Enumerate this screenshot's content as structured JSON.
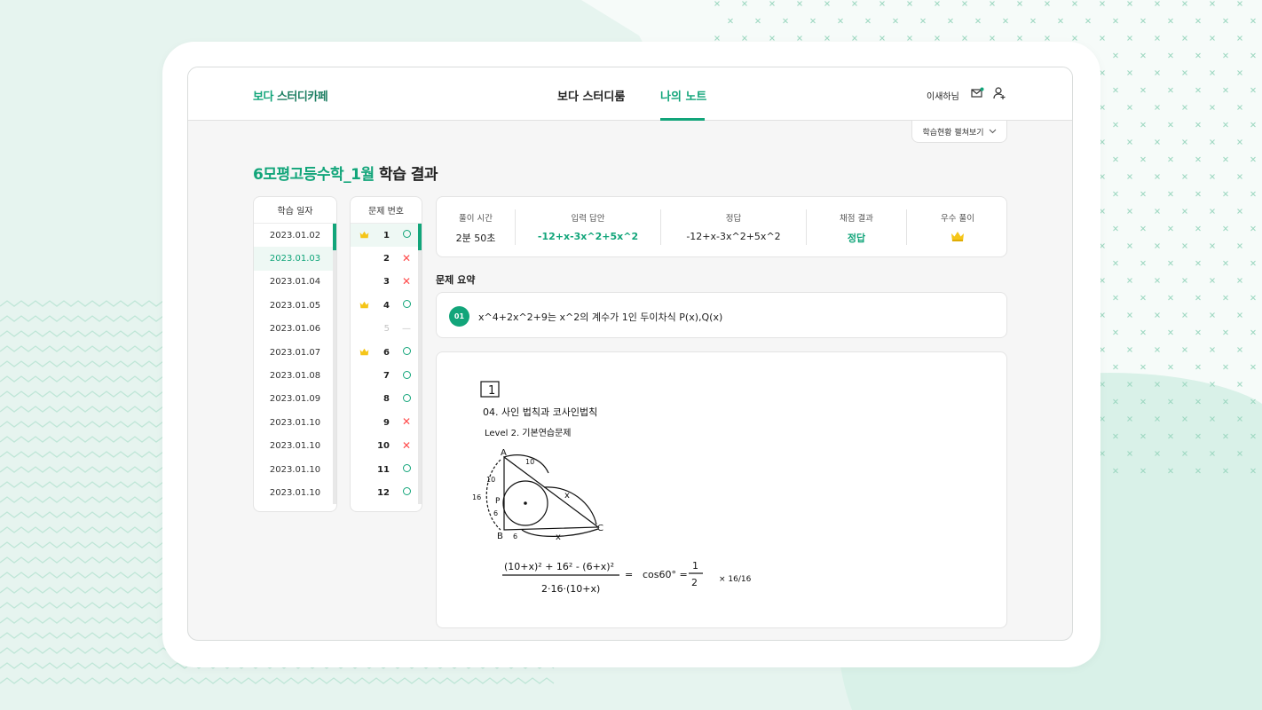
{
  "header": {
    "logo_part1": "보다",
    "logo_part2": "스터디카페",
    "nav": [
      {
        "label": "보다 스터디룸",
        "active": false
      },
      {
        "label": "나의 노트",
        "active": true
      }
    ],
    "user_name": "이새하님",
    "icons": [
      "mail-icon",
      "user-settings-icon"
    ]
  },
  "status_toggle": {
    "label": "학습현황 펼쳐보기",
    "icon": "chevron-down-icon"
  },
  "page_title": {
    "accent": "6모평고등수학_1월",
    "rest": " 학습 결과"
  },
  "dates": {
    "header": "학습 일자",
    "items": [
      "2023.01.02",
      "2023.01.03",
      "2023.01.04",
      "2023.01.05",
      "2023.01.06",
      "2023.01.07",
      "2023.01.08",
      "2023.01.09",
      "2023.01.10",
      "2023.01.10",
      "2023.01.10",
      "2023.01.10"
    ],
    "selected_index": 1,
    "scroll_fraction": 0.08
  },
  "questions": {
    "header": "문제 번호",
    "items": [
      {
        "num": "1",
        "crown": true,
        "result": "correct",
        "selected": true
      },
      {
        "num": "2",
        "crown": false,
        "result": "wrong"
      },
      {
        "num": "3",
        "crown": false,
        "result": "wrong"
      },
      {
        "num": "4",
        "crown": true,
        "result": "correct"
      },
      {
        "num": "5",
        "crown": false,
        "result": "none",
        "mark": "—"
      },
      {
        "num": "6",
        "crown": true,
        "result": "correct"
      },
      {
        "num": "7",
        "crown": false,
        "result": "correct"
      },
      {
        "num": "8",
        "crown": false,
        "result": "correct"
      },
      {
        "num": "9",
        "crown": false,
        "result": "wrong"
      },
      {
        "num": "10",
        "crown": false,
        "result": "wrong"
      },
      {
        "num": "11",
        "crown": false,
        "result": "correct"
      },
      {
        "num": "12",
        "crown": false,
        "result": "correct"
      }
    ],
    "wrong_mark": "✕"
  },
  "stats": {
    "solve_time": {
      "label": "풀이 시간",
      "value": "2분 50초"
    },
    "input_answer": {
      "label": "입력 답안",
      "value": "-12+x-3x^2+5x^2"
    },
    "correct_answer": {
      "label": "정답",
      "value": "-12+x-3x^2+5x^2"
    },
    "grading": {
      "label": "채점 결과",
      "value": "정답"
    },
    "best": {
      "label": "우수 풀이",
      "icon": "crown-icon"
    }
  },
  "summary": {
    "title": "문제 요약",
    "badge": "01",
    "text": "x^4+2x^2+9는 x^2의 계수가 1인 두이차식 P(x),Q(x)"
  },
  "handwriting": {
    "problem_no": "1",
    "line1": "04. 사인 법칙과 코사인법칙",
    "line2": "Level 2. 기본연습문제",
    "labels": {
      "a": "A",
      "b": "B",
      "c": "C",
      "p": "P",
      "x": "x",
      "n10": "10",
      "n16": "16",
      "n6": "6"
    },
    "numerator": "(10+x)² + 16² - (6+x)²",
    "denominator": "2·16·(10+x)",
    "equals": "=",
    "cos": "cos60° =",
    "frac_num": "1",
    "frac_den": "2",
    "side_mark": "× 16/16"
  },
  "colors": {
    "accent": "#12a57a",
    "wrong": "#ff4a4a",
    "crown": "#f5c518",
    "background": "#e6f4ef"
  }
}
